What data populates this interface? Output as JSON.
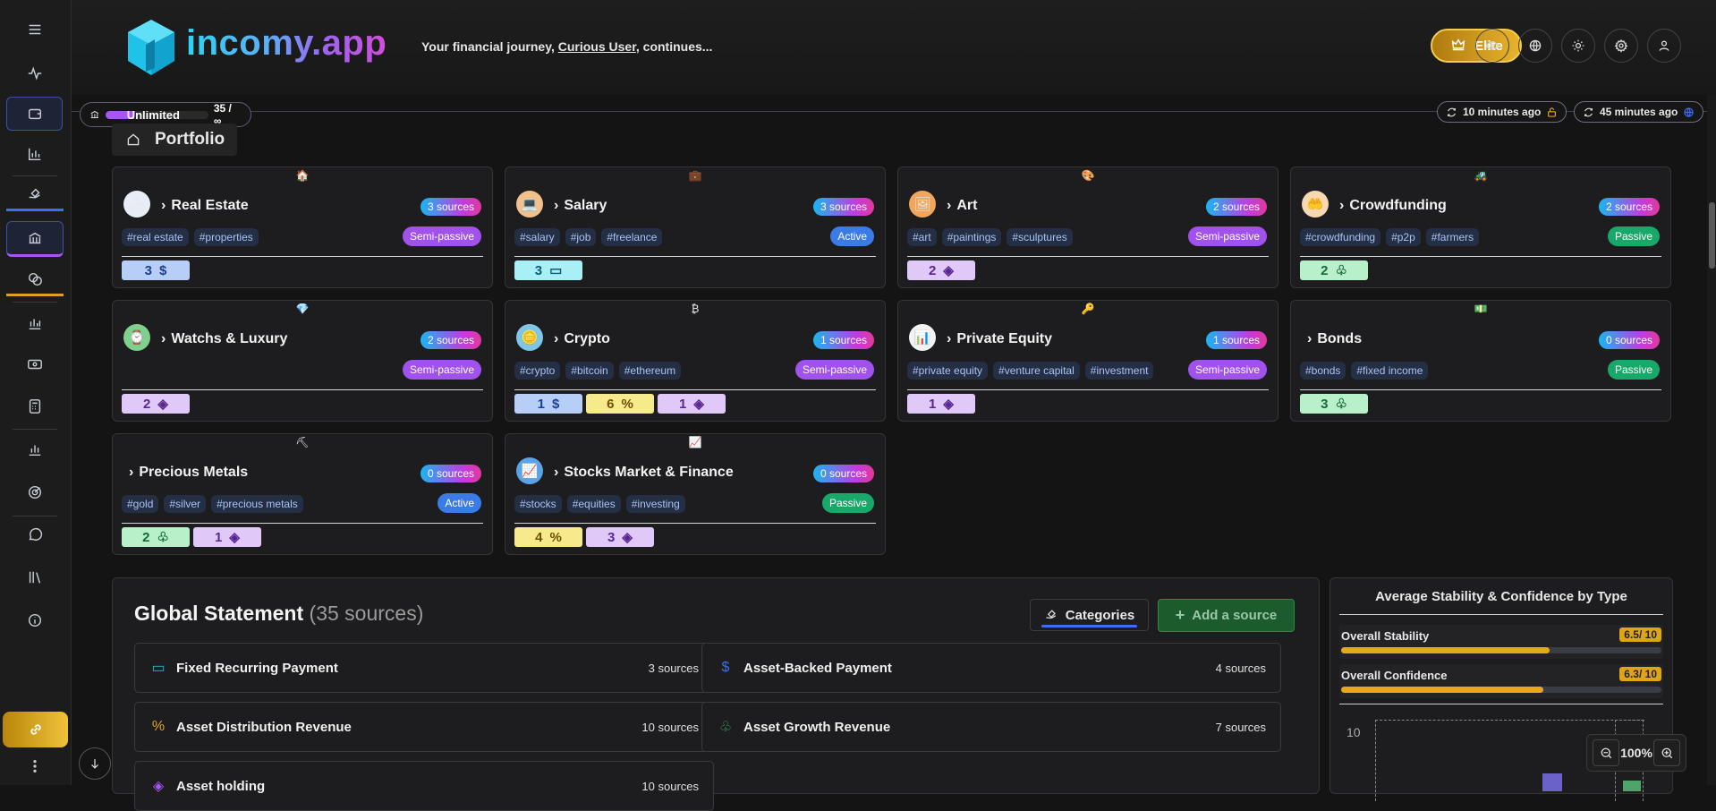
{
  "app": {
    "brand": "incomy.app",
    "tagline_prefix": "Your financial journey, ",
    "user": "Curious User",
    "tagline_suffix": ", continues...",
    "elite_label": "Elite"
  },
  "quota": {
    "label": "Unlimited",
    "count": "35 / ∞",
    "fill_fraction": 0.28
  },
  "sync": {
    "local": "10 minutes ago",
    "cloud": "45 minutes ago"
  },
  "sidebar": {
    "items": [
      {
        "icon": "menu-icon"
      },
      {
        "icon": "pulse-icon"
      },
      {
        "icon": "wallet-icon"
      },
      {
        "icon": "bar-chart-icon"
      },
      {
        "icon": "bill-hand-icon"
      },
      {
        "icon": "bank-icon"
      },
      {
        "icon": "coins-icon"
      },
      {
        "icon": "analytics-icon"
      },
      {
        "icon": "money-icon"
      },
      {
        "icon": "calculator-icon"
      },
      {
        "icon": "stats-icon"
      },
      {
        "icon": "target-icon"
      },
      {
        "icon": "chat-icon"
      },
      {
        "icon": "library-icon"
      },
      {
        "icon": "info-icon"
      },
      {
        "icon": "link-icon"
      },
      {
        "icon": "more-icon"
      }
    ]
  },
  "portfolio": {
    "title": "Portfolio",
    "categories": [
      {
        "emoji": "🏠",
        "icon": "🏘",
        "icon_bg": "#e8eef8",
        "title": "Real Estate",
        "sources": "3 sources",
        "tags": [
          "#real estate",
          "#properties"
        ],
        "type": "Semi-passive",
        "type_class": "pt-semi",
        "chips": [
          {
            "v": "3",
            "sym": "$",
            "cls": "ch-blue"
          }
        ]
      },
      {
        "emoji": "💼",
        "icon": "💻",
        "icon_bg": "#f2c08a",
        "title": "Salary",
        "sources": "3 sources",
        "tags": [
          "#salary",
          "#job",
          "#freelance"
        ],
        "type": "Active",
        "type_class": "pt-active",
        "chips": [
          {
            "v": "3",
            "sym": "▭",
            "cls": "ch-cyan"
          }
        ]
      },
      {
        "emoji": "🎨",
        "icon": "🖼",
        "icon_bg": "#f1a65a",
        "title": "Art",
        "sources": "2 sources",
        "tags": [
          "#art",
          "#paintings",
          "#sculptures"
        ],
        "type": "Semi-passive",
        "type_class": "pt-semi",
        "chips": [
          {
            "v": "2",
            "sym": "◈",
            "cls": "ch-purple"
          }
        ]
      },
      {
        "emoji": "🚜",
        "icon": "🤲",
        "icon_bg": "#f6d9b0",
        "title": "Crowdfunding",
        "sources": "2 sources",
        "tags": [
          "#crowdfunding",
          "#p2p",
          "#farmers"
        ],
        "type": "Passive",
        "type_class": "pt-passive",
        "chips": [
          {
            "v": "2",
            "sym": "♧",
            "cls": "ch-green"
          }
        ]
      },
      {
        "emoji": "💎",
        "icon": "⌚",
        "icon_bg": "#7fcf8d",
        "title": "Watchs & Luxury",
        "sources": "2 sources",
        "tags": [],
        "type": "Semi-passive",
        "type_class": "pt-semi",
        "chips": [
          {
            "v": "2",
            "sym": "◈",
            "cls": "ch-purple"
          }
        ]
      },
      {
        "emoji": "₿",
        "icon": "🪙",
        "icon_bg": "#7ec6e6",
        "title": "Crypto",
        "sources": "1 sources",
        "tags": [
          "#crypto",
          "#bitcoin",
          "#ethereum"
        ],
        "type": "Semi-passive",
        "type_class": "pt-semi",
        "chips": [
          {
            "v": "1",
            "sym": "$",
            "cls": "ch-blue"
          },
          {
            "v": "6",
            "sym": "%",
            "cls": "ch-yellow"
          },
          {
            "v": "1",
            "sym": "◈",
            "cls": "ch-purple"
          }
        ]
      },
      {
        "emoji": "🔑",
        "icon": "📊",
        "icon_bg": "#f2f2f2",
        "title": "Private Equity",
        "sources": "1 sources",
        "tags": [
          "#private equity",
          "#venture capital",
          "#investment"
        ],
        "type": "Semi-passive",
        "type_class": "pt-semi",
        "chips": [
          {
            "v": "1",
            "sym": "◈",
            "cls": "ch-purple"
          }
        ]
      },
      {
        "emoji": "💵",
        "icon": "",
        "icon_bg": "",
        "title": "Bonds",
        "sources": "0 sources",
        "tags": [
          "#bonds",
          "#fixed income"
        ],
        "type": "Passive",
        "type_class": "pt-passive",
        "chips": [
          {
            "v": "3",
            "sym": "♧",
            "cls": "ch-green"
          }
        ]
      },
      {
        "emoji": "⛏",
        "icon": "",
        "icon_bg": "",
        "title": "Precious Metals",
        "sources": "0 sources",
        "tags": [
          "#gold",
          "#silver",
          "#precious metals"
        ],
        "type": "Active",
        "type_class": "pt-active",
        "chips": [
          {
            "v": "2",
            "sym": "♧",
            "cls": "ch-green"
          },
          {
            "v": "1",
            "sym": "◈",
            "cls": "ch-purple"
          }
        ]
      },
      {
        "emoji": "📈",
        "icon": "📈",
        "icon_bg": "#5aa4e6",
        "title": "Stocks Market & Finance",
        "sources": "0 sources",
        "tags": [
          "#stocks",
          "#equities",
          "#investing"
        ],
        "type": "Passive",
        "type_class": "pt-passive",
        "chips": [
          {
            "v": "4",
            "sym": "%",
            "cls": "ch-yellow"
          },
          {
            "v": "3",
            "sym": "◈",
            "cls": "ch-purple"
          }
        ]
      }
    ]
  },
  "global": {
    "title": "Global Statement",
    "count": "(35 sources)",
    "categories_btn": "Categories",
    "add_btn": "Add a source",
    "rows": [
      {
        "icon": "▭",
        "color": "#2ab6d8",
        "name": "Fixed Recurring Payment",
        "count": "3 sources"
      },
      {
        "icon": "$",
        "color": "#3b6fe6",
        "name": "Asset-Backed Payment",
        "count": "4 sources"
      },
      {
        "icon": "%",
        "color": "#e0a516",
        "name": "Asset Distribution Revenue",
        "count": "10 sources"
      },
      {
        "icon": "♧",
        "color": "#23b35e",
        "name": "Asset Growth Revenue",
        "count": "7 sources"
      },
      {
        "icon": "◈",
        "color": "#a855f7",
        "name": "Asset holding",
        "count": "10 sources"
      }
    ]
  },
  "stability": {
    "title": "Average Stability & Confidence by Type",
    "overall_stability_label": "Overall Stability",
    "overall_stability_value": "6.5/ 10",
    "overall_stability_fraction": 0.65,
    "overall_confidence_label": "Overall Confidence",
    "overall_confidence_value": "6.3/ 10",
    "overall_confidence_fraction": 0.63,
    "chart_y_tick": "10"
  },
  "zoom": {
    "level": "100%"
  },
  "colors": {
    "accent_blue": "#3f6df3",
    "gold": "#e0a516",
    "purple": "#a855f7",
    "green": "#18a86a"
  }
}
